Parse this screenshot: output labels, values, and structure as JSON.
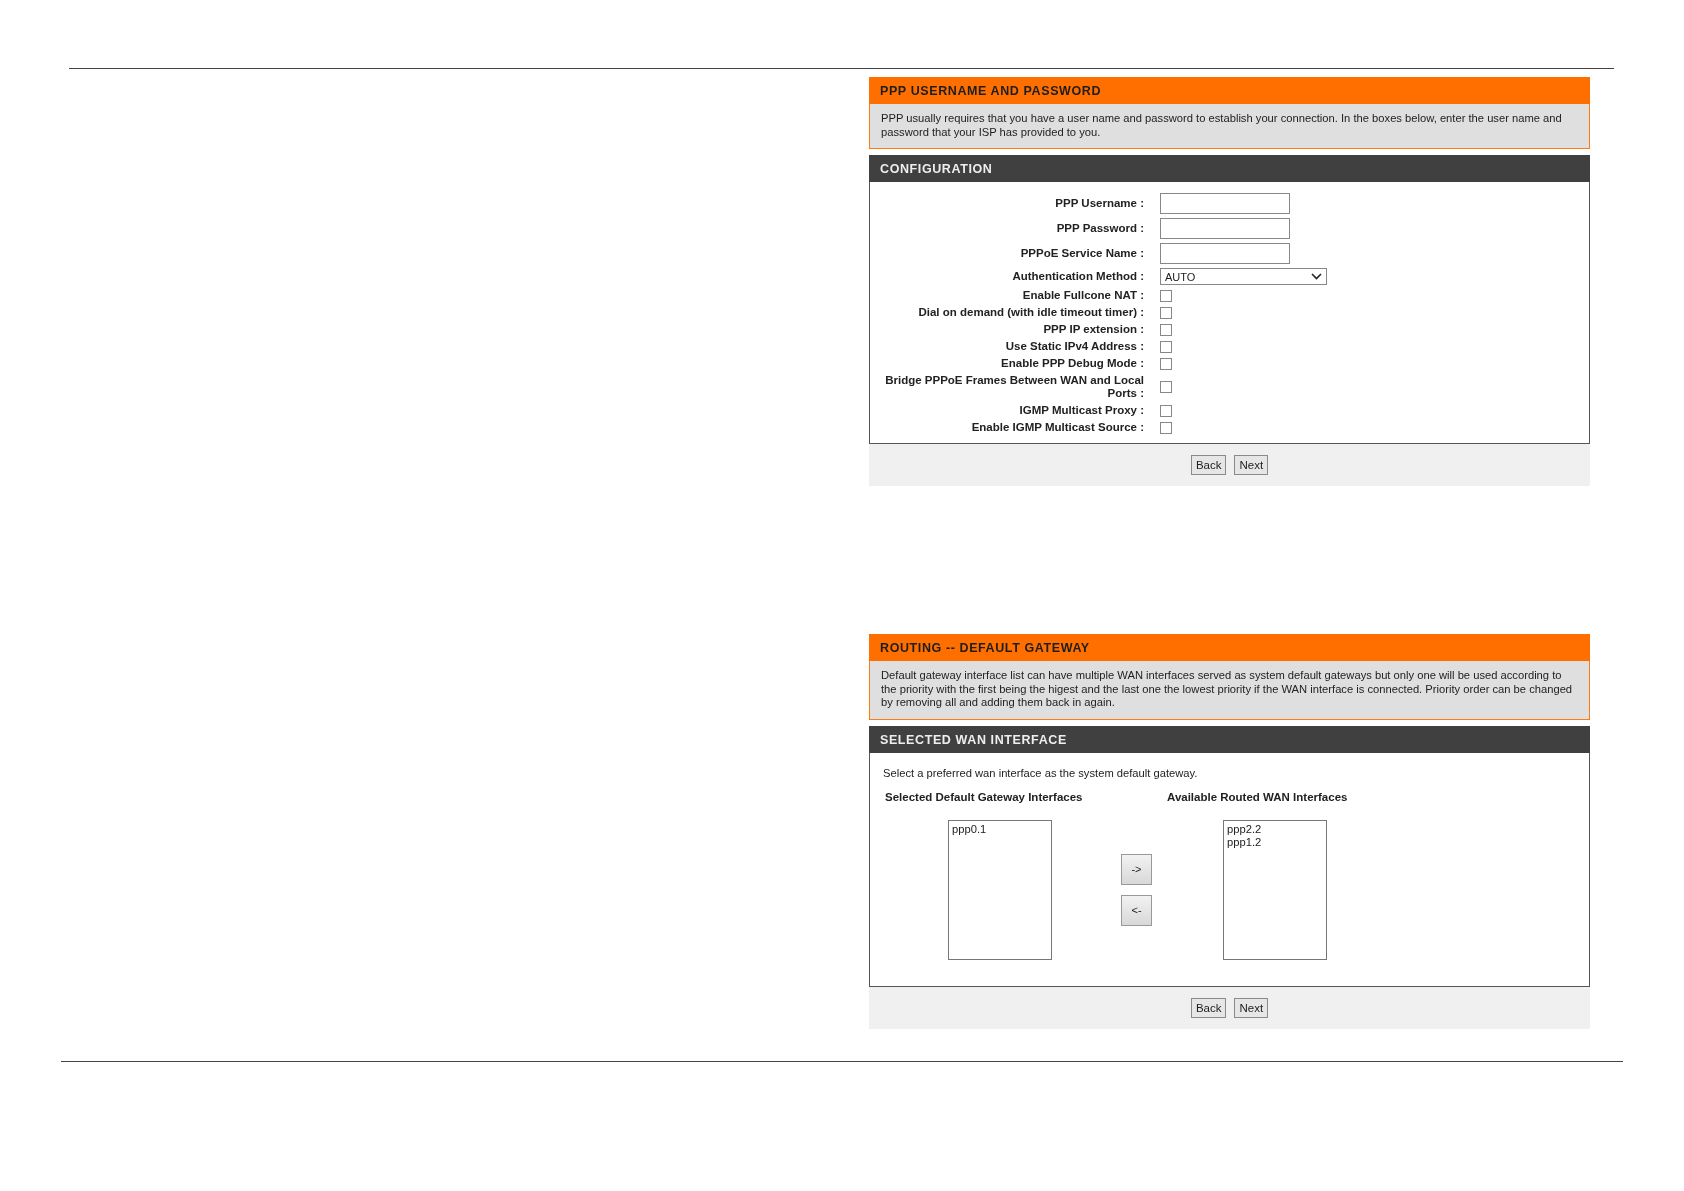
{
  "ppp_panel": {
    "title": "PPP USERNAME AND PASSWORD",
    "description": "PPP usually requires that you have a user name and password to establish your connection. In the boxes below, enter the user name and password that your ISP has provided to you.",
    "config": {
      "title": "CONFIGURATION",
      "fields": [
        {
          "kind": "text",
          "label": "PPP Username :"
        },
        {
          "kind": "text",
          "label": "PPP Password :"
        },
        {
          "kind": "text",
          "label": "PPPoE Service Name :"
        },
        {
          "kind": "select",
          "label": "Authentication Method :",
          "value": "AUTO"
        },
        {
          "kind": "checkbox",
          "label": "Enable Fullcone NAT :",
          "checked": false
        },
        {
          "kind": "checkbox",
          "label": "Dial on demand (with idle timeout timer) :",
          "checked": false
        },
        {
          "kind": "checkbox",
          "label": "PPP IP extension :",
          "checked": false
        },
        {
          "kind": "checkbox",
          "label": "Use Static IPv4 Address :",
          "checked": false
        },
        {
          "kind": "checkbox",
          "label": "Enable PPP Debug Mode :",
          "checked": false
        },
        {
          "kind": "checkbox",
          "label": "Bridge PPPoE Frames Between WAN and Local Ports :",
          "checked": false
        },
        {
          "kind": "checkbox",
          "label": "IGMP Multicast Proxy :",
          "checked": false
        },
        {
          "kind": "checkbox",
          "label": "Enable IGMP Multicast Source :",
          "checked": false
        }
      ]
    },
    "buttons": [
      "Back",
      "Next"
    ]
  },
  "routing_panel": {
    "title": "ROUTING -- DEFAULT GATEWAY",
    "description": "Default gateway interface list can have multiple WAN interfaces served as system default gateways but only one will be used according to the priority with the first being the higest and the last one the lowest priority if the WAN interface is connected. Priority order can be changed by removing all and adding them back in again.",
    "section": {
      "title": "SELECTED WAN INTERFACE",
      "instruction": "Select a preferred wan interface as the system default gateway.",
      "selected_heading": "Selected Default Gateway Interfaces",
      "available_heading": "Available Routed WAN Interfaces",
      "selected_list": [
        "ppp0.1"
      ],
      "move_buttons": [
        "->",
        "<-"
      ],
      "available_list": [
        "ppp2.2",
        "ppp1.2"
      ]
    },
    "buttons": [
      "Back",
      "Next"
    ]
  }
}
